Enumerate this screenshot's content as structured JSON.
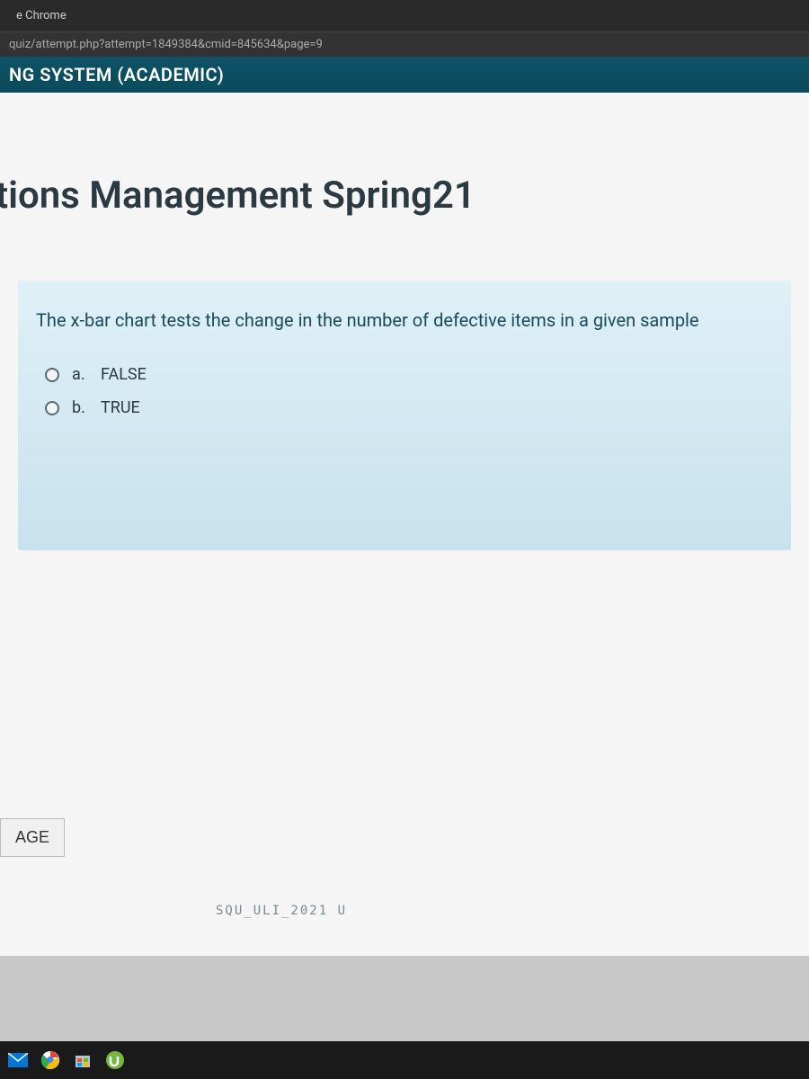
{
  "browser": {
    "tab_label": "e Chrome",
    "url": "quiz/attempt.php?attempt=1849384&cmid=845634&page=9"
  },
  "header": {
    "site_title": "NG SYSTEM (ACADEMIC)"
  },
  "course": {
    "title": "tions Management Spring21"
  },
  "question": {
    "text": "The x-bar chart tests the change in the number of defective items in a given sample",
    "options": [
      {
        "letter": "a.",
        "label": "FALSE"
      },
      {
        "letter": "b.",
        "label": "TRUE"
      }
    ]
  },
  "nav": {
    "age_button": "AGE"
  },
  "watermark": "SQU_ULI_2021 U"
}
